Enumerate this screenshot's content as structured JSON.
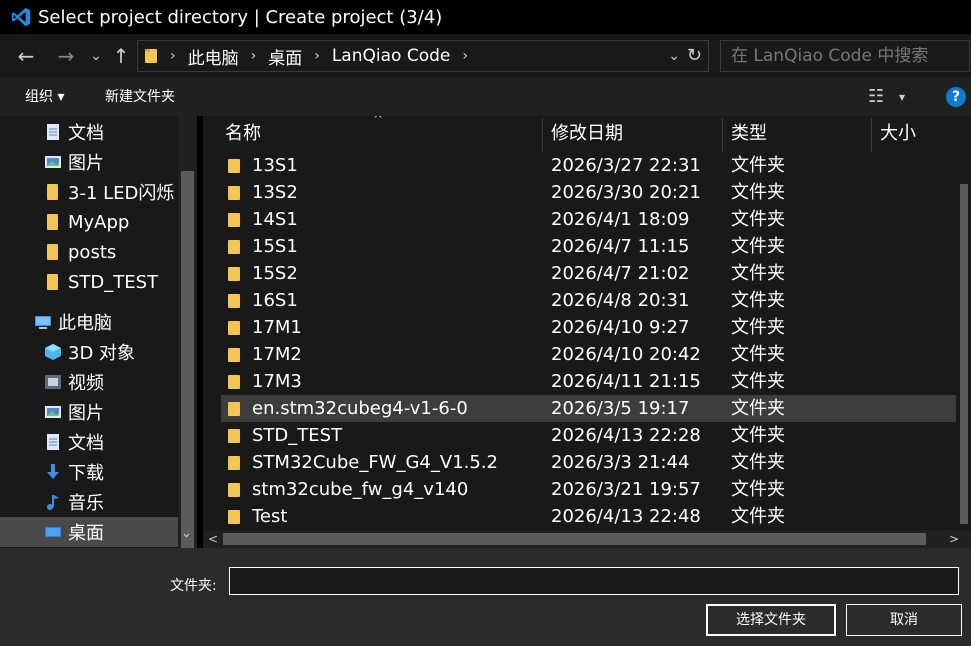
{
  "window": {
    "title": "Select project directory | Create project (3/4)"
  },
  "nav": {
    "back_icon": "←",
    "forward_icon": "→",
    "dropdown_icon": "⌄",
    "up_icon": "↑",
    "refresh_icon": "↻"
  },
  "address": {
    "separator": "›",
    "crumbs": [
      "此电脑",
      "桌面",
      "LanQiao Code"
    ]
  },
  "search": {
    "placeholder": "在 LanQiao Code 中搜索",
    "value": ""
  },
  "toolbar": {
    "organize_label": "组织 ▾",
    "new_folder_label": "新建文件夹",
    "view_icon": "☷",
    "view_dropdown": "▾",
    "help_icon": "?"
  },
  "sidebar": {
    "pin_icon": "📌",
    "quick_items": [
      {
        "label": "文档",
        "icon": "document-icon",
        "pinned": true
      },
      {
        "label": "图片",
        "icon": "picture-icon",
        "pinned": true
      },
      {
        "label": "3-1 LED闪烁",
        "icon": "folder-icon",
        "pinned": false
      },
      {
        "label": "MyApp",
        "icon": "folder-icon",
        "pinned": false
      },
      {
        "label": "posts",
        "icon": "folder-icon",
        "pinned": false
      },
      {
        "label": "STD_TEST",
        "icon": "folder-icon",
        "pinned": false
      }
    ],
    "this_pc": {
      "label": "此电脑",
      "icon": "computer-icon"
    },
    "pc_items": [
      {
        "label": "3D 对象",
        "icon": "cube-icon"
      },
      {
        "label": "视频",
        "icon": "video-icon"
      },
      {
        "label": "图片",
        "icon": "picture-icon"
      },
      {
        "label": "文档",
        "icon": "document-icon"
      },
      {
        "label": "下载",
        "icon": "download-icon"
      },
      {
        "label": "音乐",
        "icon": "music-icon"
      },
      {
        "label": "桌面",
        "icon": "desktop-icon",
        "selected": true
      }
    ],
    "scroll_down_icon": "⌄"
  },
  "columns": {
    "name": "名称",
    "date": "修改日期",
    "type": "类型",
    "size": "大小",
    "sort_icon": "^"
  },
  "files": [
    {
      "name": "13S1",
      "date": "2026/3/27 22:31",
      "type": "文件夹"
    },
    {
      "name": "13S2",
      "date": "2026/3/30 20:21",
      "type": "文件夹"
    },
    {
      "name": "14S1",
      "date": "2026/4/1 18:09",
      "type": "文件夹"
    },
    {
      "name": "15S1",
      "date": "2026/4/7 11:15",
      "type": "文件夹"
    },
    {
      "name": "15S2",
      "date": "2026/4/7 21:02",
      "type": "文件夹"
    },
    {
      "name": "16S1",
      "date": "2026/4/8 20:31",
      "type": "文件夹"
    },
    {
      "name": "17M1",
      "date": "2026/4/10 9:27",
      "type": "文件夹"
    },
    {
      "name": "17M2",
      "date": "2026/4/10 20:42",
      "type": "文件夹"
    },
    {
      "name": "17M3",
      "date": "2026/4/11 21:15",
      "type": "文件夹"
    },
    {
      "name": "en.stm32cubeg4-v1-6-0",
      "date": "2026/3/5 19:17",
      "type": "文件夹",
      "hover": true
    },
    {
      "name": "STD_TEST",
      "date": "2026/4/13 22:28",
      "type": "文件夹"
    },
    {
      "name": "STM32Cube_FW_G4_V1.5.2",
      "date": "2026/3/3 21:44",
      "type": "文件夹"
    },
    {
      "name": "stm32cube_fw_g4_v140",
      "date": "2026/3/21 19:57",
      "type": "文件夹"
    },
    {
      "name": "Test",
      "date": "2026/4/13 22:48",
      "type": "文件夹"
    }
  ],
  "hscroll": {
    "left_icon": "<",
    "right_icon": ">"
  },
  "footer": {
    "folder_label": "文件夹:",
    "folder_value": "",
    "select_button": "选择文件夹",
    "cancel_button": "取消"
  },
  "colors": {
    "folder": "#f3c554",
    "accent": "#0e7ad1",
    "background": "#191919"
  }
}
